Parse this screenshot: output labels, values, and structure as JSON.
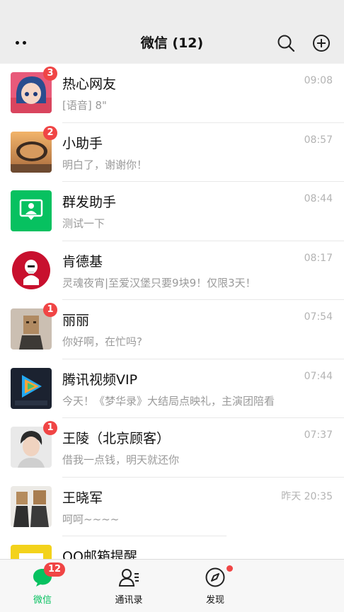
{
  "header": {
    "title": "微信 (12)",
    "more_icon": "more-dots-icon",
    "search_icon": "search-icon",
    "add_icon": "plus-circle-icon"
  },
  "chats": [
    {
      "name": "热心网友",
      "message": "[语音] 8\"",
      "time": "09:08",
      "badge": "3",
      "avatar": "anime-girl-avatar"
    },
    {
      "name": "小助手",
      "message": "明白了，谢谢你！",
      "time": "08:57",
      "badge": "2",
      "avatar": "car-mirror-sunset-avatar"
    },
    {
      "name": "群发助手",
      "message": "测试一下",
      "time": "08:44",
      "badge": "",
      "avatar": "broadcast-helper-avatar"
    },
    {
      "name": "肯德基",
      "message": "灵魂夜宵|至爱汉堡只要9块9！仅限3天！",
      "time": "08:17",
      "badge": "",
      "avatar": "kfc-logo-avatar"
    },
    {
      "name": "丽丽",
      "message": "你好啊，在忙吗?",
      "time": "07:54",
      "badge": "1",
      "avatar": "paper-bag-person-avatar"
    },
    {
      "name": "腾讯视频VIP",
      "message": "今天！《梦华录》大结局点映礼，主演团陪看",
      "time": "07:44",
      "badge": "",
      "avatar": "tencent-video-vip-avatar"
    },
    {
      "name": "王陵（北京顾客）",
      "message": "借我一点钱，明天就还你",
      "time": "07:37",
      "badge": "1",
      "avatar": "young-man-avatar"
    },
    {
      "name": "王晓军",
      "message": "呵呵~~~~",
      "time": "昨天 20:35",
      "badge": "",
      "avatar": "paper-bag-couple-avatar"
    },
    {
      "name": "QQ邮箱提醒",
      "message": "",
      "time": "",
      "badge": "",
      "avatar": "qq-mail-avatar"
    }
  ],
  "tabbar": {
    "tabs": [
      {
        "label": "微信",
        "badge": "12",
        "active": true,
        "icon": "chat-bubble-icon"
      },
      {
        "label": "通讯录",
        "badge": "",
        "active": false,
        "icon": "contacts-icon"
      },
      {
        "label": "发现",
        "badge": "",
        "active": false,
        "icon": "compass-icon"
      }
    ]
  },
  "colors": {
    "accent_green": "#07c160",
    "badge_red": "#f04545",
    "header_bg": "#ededed"
  }
}
